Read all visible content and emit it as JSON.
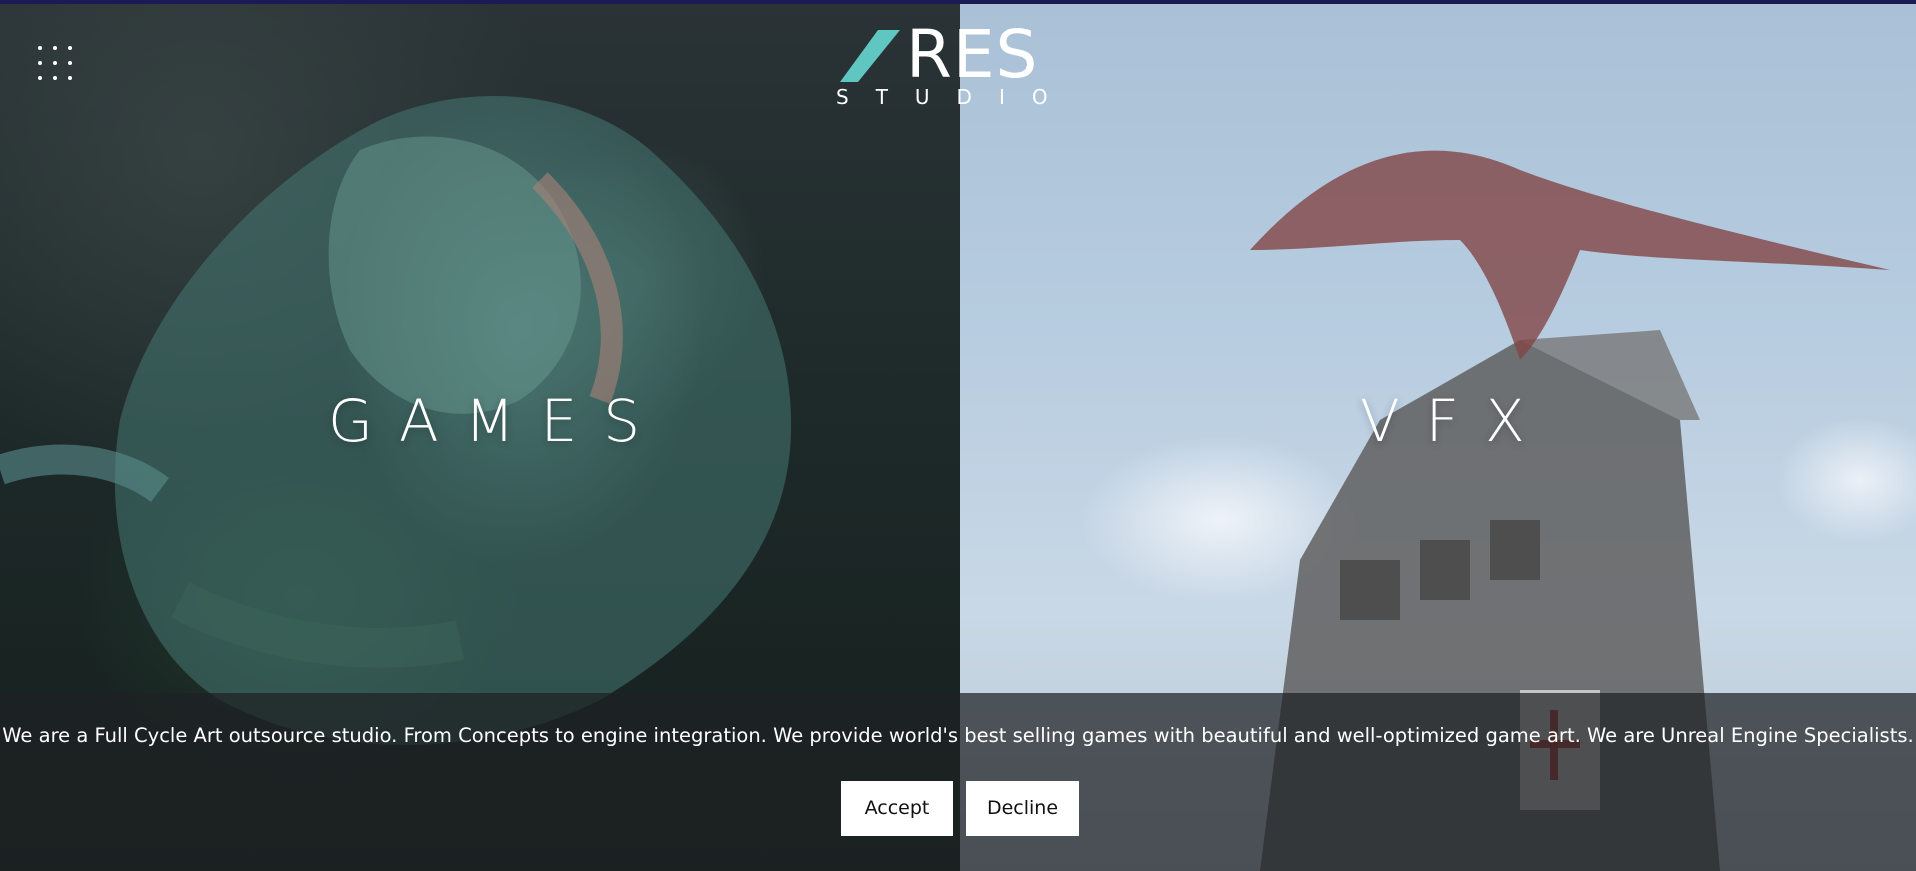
{
  "header": {
    "menu_icon": "grid-menu-icon",
    "logo": {
      "word": "RES",
      "tagline": "STUDIO",
      "accent_color": "#5fc6c2"
    }
  },
  "panels": {
    "games": {
      "label": "GAMES"
    },
    "vfx": {
      "label": "VFX"
    }
  },
  "cookie_banner": {
    "message": "We are a Full Cycle Art outsource studio. From Concepts to engine integration. We provide world's best selling games with beautiful and well-optimized game art. We are Unreal Engine Specialists.",
    "accept_label": "Accept",
    "decline_label": "Decline"
  },
  "colors": {
    "top_strip": "#1b1a55",
    "banner_background": "#1e2124",
    "button_background": "#ffffff"
  }
}
